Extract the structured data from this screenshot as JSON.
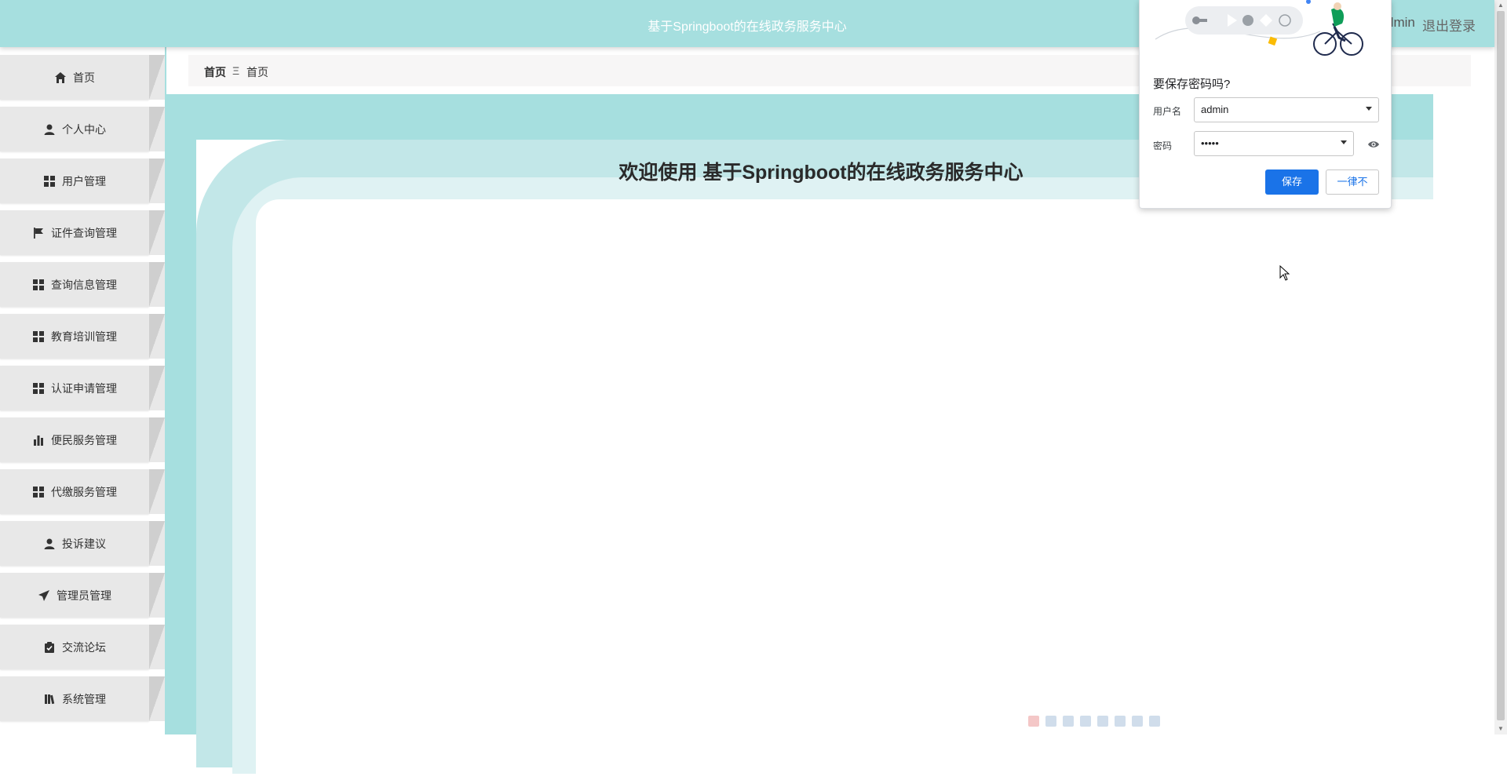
{
  "header": {
    "title": "基于Springboot的在线政务服务中心",
    "user": "dmin",
    "logout": "退出登录",
    "bg_color": "#a6dfdf"
  },
  "sidebar": {
    "items": [
      {
        "label": "首页",
        "icon": "home-icon"
      },
      {
        "label": "个人中心",
        "icon": "user-icon"
      },
      {
        "label": "用户管理",
        "icon": "grid-icon"
      },
      {
        "label": "证件查询管理",
        "icon": "flag-icon"
      },
      {
        "label": "查询信息管理",
        "icon": "grid-icon"
      },
      {
        "label": "教育培训管理",
        "icon": "grid-icon"
      },
      {
        "label": "认证申请管理",
        "icon": "grid-icon"
      },
      {
        "label": "便民服务管理",
        "icon": "bar-chart-icon"
      },
      {
        "label": "代缴服务管理",
        "icon": "grid-icon"
      },
      {
        "label": "投诉建议",
        "icon": "user-icon"
      },
      {
        "label": "管理员管理",
        "icon": "paper-plane-icon"
      },
      {
        "label": "交流论坛",
        "icon": "clipboard-icon"
      },
      {
        "label": "系统管理",
        "icon": "book-icon"
      }
    ]
  },
  "breadcrumb": {
    "home": "首页",
    "separator": "Ξ",
    "current": "首页"
  },
  "main": {
    "welcome": "欢迎使用 基于Springboot的在线政务服务中心"
  },
  "password_popup": {
    "title": "要保存密码吗?",
    "username_label": "用户名",
    "username_value": "admin",
    "password_label": "密码",
    "password_value": "•••••",
    "save_label": "保存",
    "never_label": "一律不"
  }
}
